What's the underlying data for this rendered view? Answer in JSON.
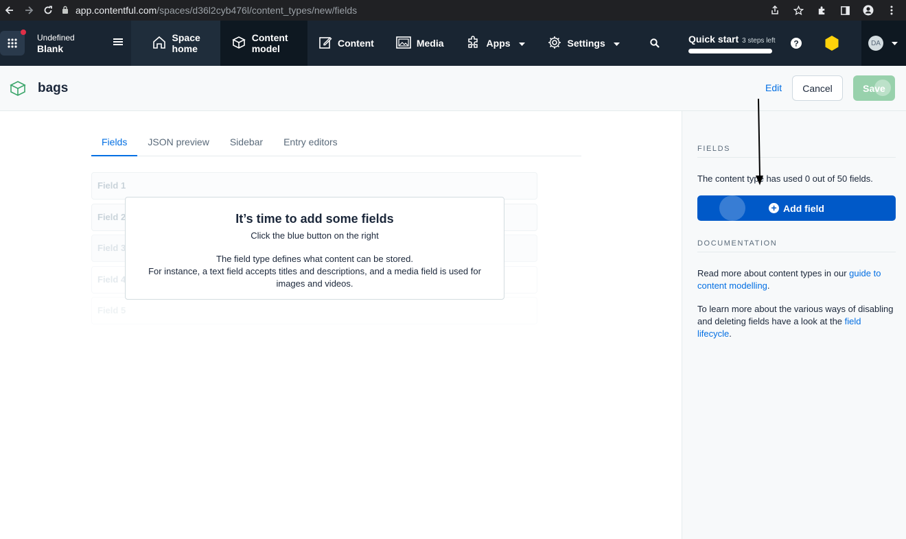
{
  "browser": {
    "url_host": "app.contentful.com",
    "url_path": "/spaces/d36l2cyb476l/content_types/new/fields",
    "icons": [
      "back-icon",
      "forward-icon",
      "reload-icon",
      "lock-icon",
      "share-icon",
      "star-icon",
      "extensions-icon",
      "sidebar-icon",
      "profile-icon",
      "kebab-menu-icon"
    ]
  },
  "nav": {
    "org_name": "Undefined",
    "space_name": "Blank",
    "items": [
      {
        "line1": "Space",
        "line2": "home",
        "icon": "home-icon"
      },
      {
        "line1": "Content",
        "line2": "model",
        "icon": "content-model-icon"
      },
      {
        "label": "Content",
        "icon": "edit-icon"
      },
      {
        "label": "Media",
        "icon": "media-icon"
      },
      {
        "label": "Apps",
        "icon": "puzzle-icon"
      },
      {
        "label": "Settings",
        "icon": "gear-icon"
      }
    ],
    "quick_start": {
      "title": "Quick start",
      "steps": "3 steps left",
      "progress": 1.0
    },
    "avatar_initials": "DA",
    "colors": {
      "background": "#192532",
      "active": "#0e1821",
      "notification": "#e02f47",
      "hex_badge": "#ffd20a"
    }
  },
  "header": {
    "title": "bags",
    "edit_label": "Edit",
    "cancel_label": "Cancel",
    "save_label": "Save"
  },
  "tabs": [
    {
      "label": "Fields",
      "active": true
    },
    {
      "label": "JSON preview",
      "active": false
    },
    {
      "label": "Sidebar",
      "active": false
    },
    {
      "label": "Entry editors",
      "active": false
    }
  ],
  "placeholder_fields": [
    "Field 1",
    "Field 2",
    "Field 3",
    "Field 4",
    "Field 5"
  ],
  "empty_state": {
    "title": "It’s time to add some fields",
    "subtitle": "Click the blue button on the right",
    "desc_line1": "The field type defines what content can be stored.",
    "desc_line2": "For instance, a text field accepts titles and descriptions, and a media field is used for images and videos."
  },
  "sidebar": {
    "fields_heading": "FIELDS",
    "fields_usage": "The content type has used 0 out of 50 fields.",
    "add_field_label": "Add field",
    "doc_heading": "DOCUMENTATION",
    "doc_text1": "Read more about content types in our",
    "doc_link1": "guide to content modelling",
    "doc_text2": "To learn more about the various ways of disabling and deleting fields have a look at the",
    "doc_link2": "field lifecycle"
  },
  "colors": {
    "primary": "#036fe3",
    "add_button": "#0059c8",
    "save_disabled": "#98d1ac"
  }
}
